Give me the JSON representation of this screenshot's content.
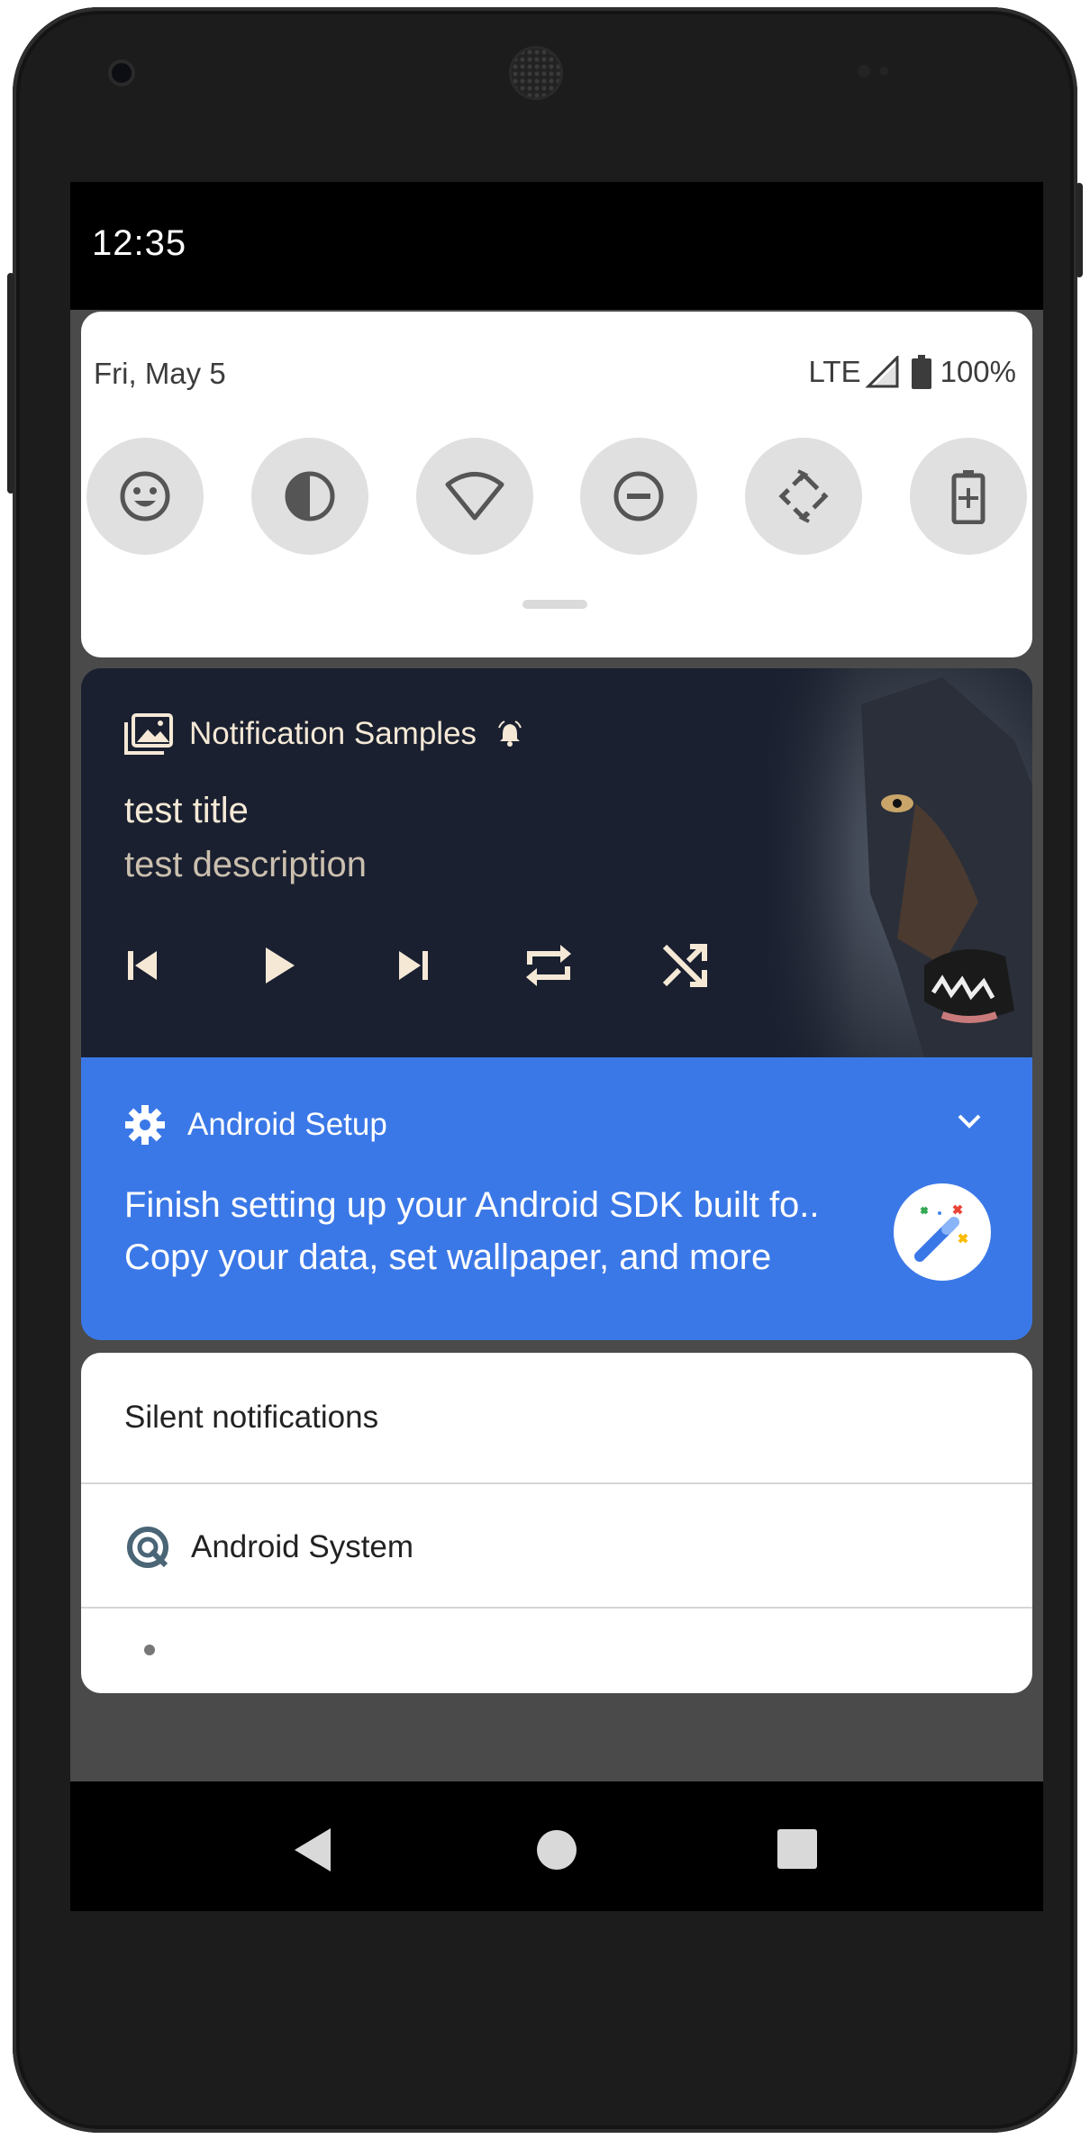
{
  "status_bar": {
    "time": "12:35"
  },
  "quick_settings": {
    "date": "Fri, May 5",
    "network": "LTE",
    "battery": "100%",
    "tiles": [
      "emoji-icon",
      "contrast-icon",
      "wifi-icon",
      "do-not-disturb-icon",
      "auto-rotate-icon",
      "battery-saver-icon"
    ]
  },
  "media_notification": {
    "app_name": "Notification Samples",
    "title": "test title",
    "description": "test description",
    "controls": [
      "skip-previous-icon",
      "play-icon",
      "skip-next-icon",
      "repeat-icon",
      "shuffle-icon"
    ]
  },
  "setup_notification": {
    "app_name": "Android Setup",
    "line1": "Finish setting up your Android SDK built fo..",
    "line2": "Copy your data, set wallpaper, and more"
  },
  "silent_section": {
    "header": "Silent notifications",
    "app_name": "Android System"
  },
  "colors": {
    "media_bg": "#1a2030",
    "setup_bg": "#3b78e7",
    "media_text": "#f5e9d6"
  }
}
